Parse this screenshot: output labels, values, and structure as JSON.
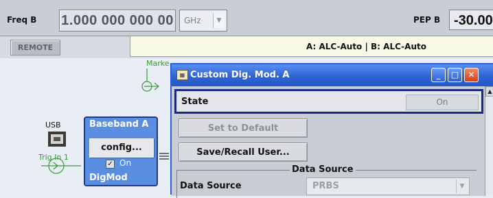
{
  "topbar": {
    "freq_label": "Freq B",
    "freq_value": "1.000 000 000 00",
    "unit": "GHz",
    "pep_label": "PEP B",
    "pep_value": "-30.00"
  },
  "status": {
    "remote": "REMOTE",
    "alc": "A: ALC-Auto | B: ALC-Auto"
  },
  "diagram": {
    "marker_label": "Marke",
    "usb_label": "USB",
    "trig_label": "Trig In 1",
    "baseband": {
      "title": "Baseband A",
      "config": "config...",
      "on_label": "On",
      "mode": "DigMod",
      "checked": true
    }
  },
  "dialog": {
    "title": "Custom Dig. Mod. A",
    "state_label": "State",
    "state_value": "On",
    "set_default": "Set to Default",
    "save_recall": "Save/Recall User...",
    "data_source_group": "Data Source",
    "data_source_label": "Data Source",
    "data_source_value": "PRBS"
  },
  "colors": {
    "titlebar": "#2d64d4",
    "baseband_block": "#5a8ee0",
    "marker_green": "#3a9a3a",
    "state_border": "#142a84"
  }
}
